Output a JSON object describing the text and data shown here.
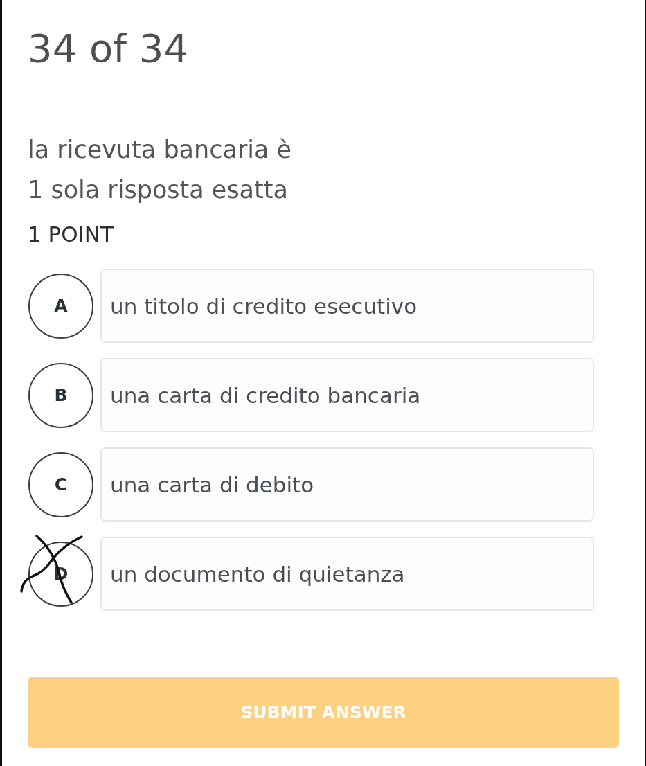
{
  "header": {
    "counter": "34 of 34"
  },
  "question": {
    "text": "la ricevuta bancaria è",
    "instruction": "1 sola risposta esatta",
    "points": "1 POINT"
  },
  "options": [
    {
      "letter": "A",
      "text": "un titolo di credito esecutivo",
      "selected": false,
      "crossed_out": false
    },
    {
      "letter": "B",
      "text": "una carta di credito bancaria",
      "selected": false,
      "crossed_out": false
    },
    {
      "letter": "C",
      "text": "una carta di debito",
      "selected": false,
      "crossed_out": false
    },
    {
      "letter": "D",
      "text": "un documento di quietanza",
      "selected": false,
      "crossed_out": true
    }
  ],
  "submit_button": {
    "label": "SUBMIT ANSWER",
    "disabled": true
  }
}
